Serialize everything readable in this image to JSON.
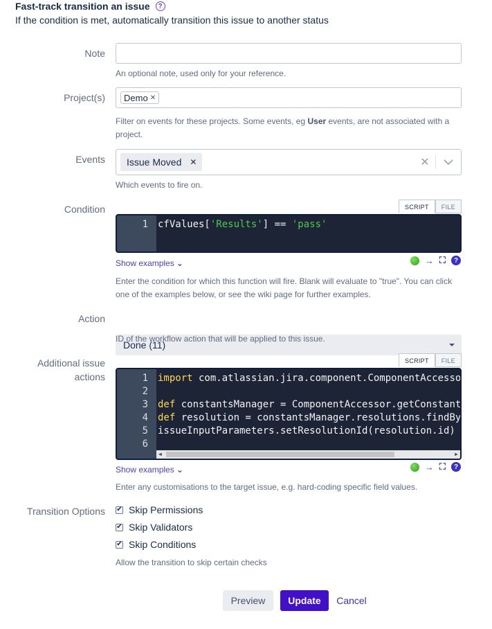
{
  "header": {
    "title": "Fast-track transition an issue",
    "subtitle": "If the condition is met, automatically transition this issue to another status"
  },
  "note": {
    "label": "Note",
    "value": "",
    "help": "An optional note, used only for your reference."
  },
  "projects": {
    "label": "Project(s)",
    "tags": [
      "Demo"
    ],
    "help_before": "Filter on events for these projects. Some events, eg ",
    "help_bold": "User",
    "help_after": " events, are not associated with a project."
  },
  "events": {
    "label": "Events",
    "selected": [
      "Issue Moved"
    ],
    "help": "Which events to fire on."
  },
  "condition": {
    "label": "Condition",
    "tabs": [
      "SCRIPT",
      "FILE"
    ],
    "active_tab": "SCRIPT",
    "lines": [
      {
        "n": "1",
        "tokens": [
          {
            "t": "cfValues[",
            "c": "plain"
          },
          {
            "t": "'Results'",
            "c": "str"
          },
          {
            "t": "] == ",
            "c": "plain"
          },
          {
            "t": "'pass'",
            "c": "str"
          }
        ]
      }
    ],
    "show_examples": "Show examples",
    "help": "Enter the condition for which this function will fire. Blank will evaluate to \"true\". You can click one of the examples below, or see the wiki page for further examples."
  },
  "action": {
    "label": "Action",
    "value": "Done (11)",
    "help": "ID of the workflow action that will be applied to this issue."
  },
  "additional_actions": {
    "label_line1": "Additional issue",
    "label_line2": "actions",
    "tabs": [
      "SCRIPT",
      "FILE"
    ],
    "active_tab": "SCRIPT",
    "lines": [
      {
        "n": "1",
        "tokens": [
          {
            "t": "import",
            "c": "kw"
          },
          {
            "t": " com.atlassian.jira.component.ComponentAccesso",
            "c": "plain"
          }
        ]
      },
      {
        "n": "2",
        "tokens": []
      },
      {
        "n": "3",
        "tokens": [
          {
            "t": "def",
            "c": "kw"
          },
          {
            "t": " constantsManager = ComponentAccessor.getConstant",
            "c": "plain"
          }
        ]
      },
      {
        "n": "4",
        "tokens": [
          {
            "t": "def",
            "c": "kw"
          },
          {
            "t": " resolution = constantsManager.resolutions.findBy",
            "c": "plain"
          }
        ]
      },
      {
        "n": "5",
        "tokens": [
          {
            "t": "issueInputParameters.setResolutionId(resolution.id)",
            "c": "plain"
          }
        ]
      },
      {
        "n": "6",
        "tokens": []
      }
    ],
    "show_examples": "Show examples",
    "help": "Enter any customisations to the target issue, e.g. hard-coding specific field values."
  },
  "transition_options": {
    "label": "Transition Options",
    "options": [
      {
        "label": "Skip Permissions",
        "checked": true
      },
      {
        "label": "Skip Validators",
        "checked": true
      },
      {
        "label": "Skip Conditions",
        "checked": true
      }
    ],
    "help": "Allow the transition to skip certain checks"
  },
  "buttons": {
    "preview": "Preview",
    "update": "Update",
    "cancel": "Cancel"
  },
  "colors": {
    "primary": "#4210c8",
    "link": "#3b31c6",
    "editor_bg": "#1d2436",
    "keyword": "#ffd84a",
    "string": "#4ec94e"
  }
}
